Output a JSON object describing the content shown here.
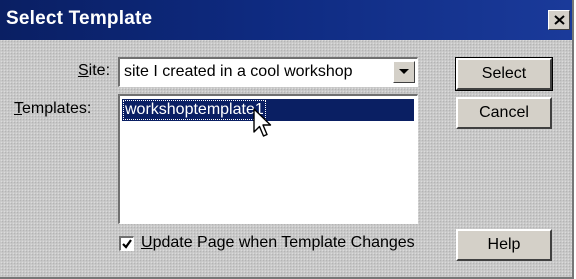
{
  "window": {
    "title": "Select Template"
  },
  "site": {
    "label_mnemonic": "S",
    "label_rest": "ite:",
    "selected": "site I created in a cool workshop"
  },
  "templates": {
    "label_mnemonic": "T",
    "label_rest": "emplates:",
    "items": [
      "workshoptemplate1"
    ],
    "selected_index": 0
  },
  "buttons": {
    "select": "Select",
    "cancel": "Cancel",
    "help": "Help"
  },
  "update_option": {
    "checked": true,
    "label_mnemonic": "U",
    "label_rest": "pdate Page when Template Changes"
  },
  "colors": {
    "titlebar": "#0a1f63",
    "selection": "#0a1f63",
    "face": "#d4d0c8"
  },
  "icons": {
    "close": "close-icon",
    "dropdown": "chevron-down-icon",
    "check": "checkmark-icon",
    "pointer": "mouse-pointer-icon"
  }
}
